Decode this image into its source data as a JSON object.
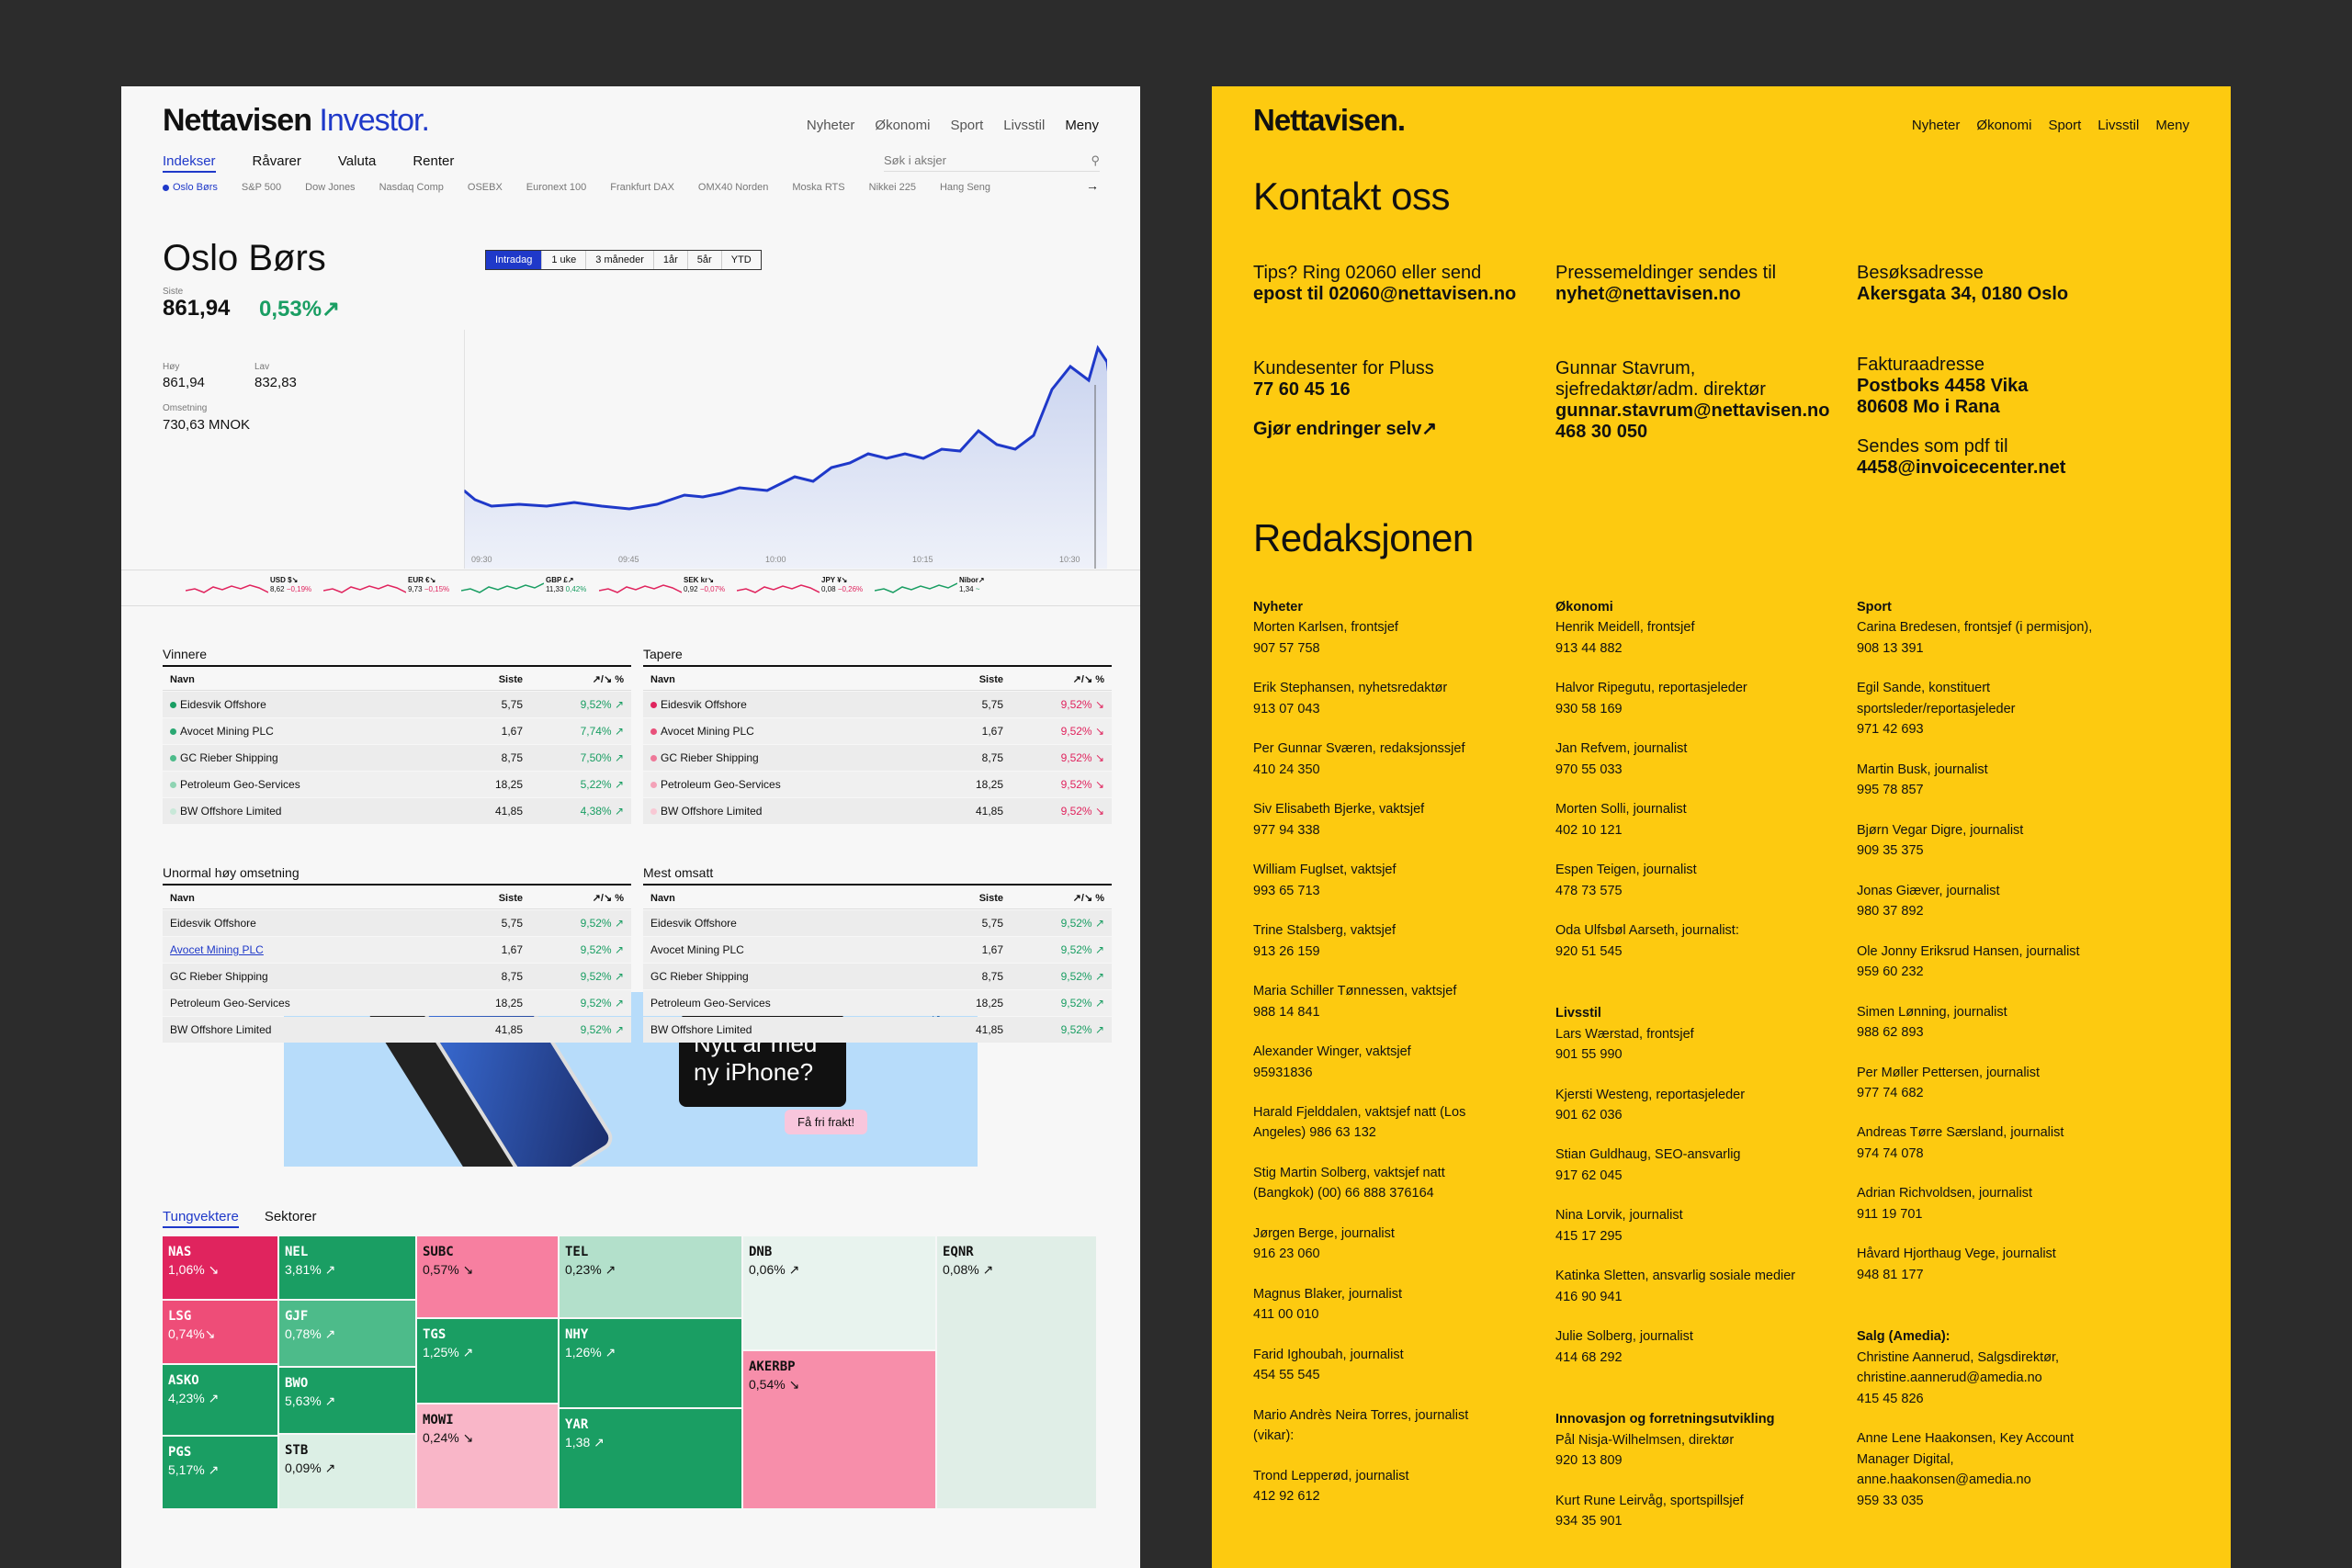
{
  "left": {
    "logo_main": "Nettavisen",
    "logo_sub": "Investor.",
    "nav": [
      "Nyheter",
      "Økonomi",
      "Sport",
      "Livsstil",
      "Meny"
    ],
    "tabs": [
      "Indekser",
      "Råvarer",
      "Valuta",
      "Renter"
    ],
    "search_placeholder": "Søk i aksjer",
    "indices": [
      "Oslo Børs",
      "S&P 500",
      "Dow Jones",
      "Nasdaq Comp",
      "OSEBX",
      "Euronext 100",
      "Frankfurt DAX",
      "OMX40 Norden",
      "Moska RTS",
      "Nikkei 225",
      "Hang Seng"
    ],
    "title": "Oslo Børs",
    "last_label": "Siste",
    "last_value": "861,94",
    "change": "0,53%↗",
    "high_label": "Høy",
    "high_value": "861,94",
    "low_label": "Lav",
    "low_value": "832,83",
    "turnover_label": "Omsetning",
    "turnover_value": "730,63 MNOK",
    "ranges": [
      "Intradag",
      "1 uke",
      "3 måneder",
      "1år",
      "5år",
      "YTD"
    ],
    "chart_times": [
      "09:30",
      "09:45",
      "10:00",
      "10:15",
      "10:30"
    ],
    "tickers": [
      {
        "name": "USD $↘",
        "value": "8,62",
        "chg": "−0,19%",
        "dir": "dn"
      },
      {
        "name": "EUR €↘",
        "value": "9,73",
        "chg": "−0,15%",
        "dir": "dn"
      },
      {
        "name": "GBP £↗",
        "value": "11,33",
        "chg": "0,42%",
        "dir": "up"
      },
      {
        "name": "SEK kr↘",
        "value": "0,92",
        "chg": "−0,07%",
        "dir": "dn"
      },
      {
        "name": "JPY ¥↘",
        "value": "0,08",
        "chg": "−0,26%",
        "dir": "dn"
      },
      {
        "name": "Nibor↗",
        "value": "1,34",
        "chg": "~",
        "dir": "up"
      }
    ],
    "tables": [
      {
        "caption": "Vinnere",
        "head": [
          "Navn",
          "Siste",
          "↗/↘ %"
        ],
        "dots": true,
        "rows": [
          [
            "Eidesvik Offshore",
            "5,75",
            "9,52% ↗",
            "up",
            "#1a9e63"
          ],
          [
            "Avocet Mining PLC",
            "1,67",
            "7,74% ↗",
            "up",
            "#2aa873"
          ],
          [
            "GC Rieber Shipping",
            "8,75",
            "7,50% ↗",
            "up",
            "#4dbb8a"
          ],
          [
            "Petroleum Geo-Services",
            "18,25",
            "5,22% ↗",
            "up",
            "#8fd4b3"
          ],
          [
            "BW Offshore Limited",
            "41,85",
            "4,38% ↗",
            "up",
            "#c8e8d8"
          ]
        ]
      },
      {
        "caption": "Tapere",
        "head": [
          "Navn",
          "Siste",
          "↗/↘ %"
        ],
        "dots": true,
        "rows": [
          [
            "Eidesvik Offshore",
            "5,75",
            "9,52% ↘",
            "dn",
            "#e0245e"
          ],
          [
            "Avocet Mining PLC",
            "1,67",
            "9,52% ↘",
            "dn",
            "#e8507a"
          ],
          [
            "GC Rieber Shipping",
            "8,75",
            "9,52% ↘",
            "dn",
            "#ee7898"
          ],
          [
            "Petroleum Geo-Services",
            "18,25",
            "9,52% ↘",
            "dn",
            "#f4a2b8"
          ],
          [
            "BW Offshore Limited",
            "41,85",
            "9,52% ↘",
            "dn",
            "#f8c8d4"
          ]
        ]
      },
      {
        "caption": "Unormal høy omsetning",
        "head": [
          "Navn",
          "Siste",
          "↗/↘ %"
        ],
        "dots": false,
        "rows": [
          [
            "Eidesvik Offshore",
            "5,75",
            "9,52% ↗",
            "up",
            ""
          ],
          [
            "Avocet Mining PLC",
            "1,67",
            "9,52% ↗",
            "up",
            ""
          ],
          [
            "GC Rieber Shipping",
            "8,75",
            "9,52% ↗",
            "up",
            ""
          ],
          [
            "Petroleum Geo-Services",
            "18,25",
            "9,52% ↗",
            "up",
            ""
          ],
          [
            "BW Offshore Limited",
            "41,85",
            "9,52% ↗",
            "up",
            ""
          ]
        ]
      },
      {
        "caption": "Mest omsatt",
        "head": [
          "Navn",
          "Siste",
          "↗/↘ %"
        ],
        "dots": false,
        "rows": [
          [
            "Eidesvik Offshore",
            "5,75",
            "9,52% ↗",
            "up",
            ""
          ],
          [
            "Avocet Mining PLC",
            "1,67",
            "9,52% ↗",
            "up",
            ""
          ],
          [
            "GC Rieber Shipping",
            "8,75",
            "9,52% ↗",
            "up",
            ""
          ],
          [
            "Petroleum Geo-Services",
            "18,25",
            "9,52% ↗",
            "up",
            ""
          ],
          [
            "BW Offshore Limited",
            "41,85",
            "9,52% ↗",
            "up",
            ""
          ]
        ]
      }
    ],
    "ad_text1": "Nytt år med",
    "ad_text2": "ny iPhone?",
    "ad_cta": "Få fri frakt!",
    "heat_tabs": [
      "Tungvektere",
      "Sektorer"
    ],
    "tiles": [
      {
        "name": "NAS",
        "val": "1,06% ↘"
      },
      {
        "name": "NEL",
        "val": "3,81% ↗"
      },
      {
        "name": "SUBC",
        "val": "0,57% ↘"
      },
      {
        "name": "TEL",
        "val": "0,23% ↗"
      },
      {
        "name": "DNB",
        "val": "0,06% ↗"
      },
      {
        "name": "EQNR",
        "val": "0,08% ↗"
      },
      {
        "name": "LSG",
        "val": "0,74%↘"
      },
      {
        "name": "GJF",
        "val": "0,78% ↗"
      },
      {
        "name": "TGS",
        "val": "1,25% ↗"
      },
      {
        "name": "NHY",
        "val": "1,26% ↗"
      },
      {
        "name": "AKERBP",
        "val": "0,54% ↘"
      },
      {
        "name": "ASKO",
        "val": "4,23% ↗"
      },
      {
        "name": "BWO",
        "val": "5,63% ↗"
      },
      {
        "name": "MOWI",
        "val": "0,24% ↘"
      },
      {
        "name": "YAR",
        "val": "1,38 ↗"
      },
      {
        "name": "PGS",
        "val": "5,17% ↗"
      },
      {
        "name": "STB",
        "val": "0,09% ↗"
      }
    ]
  },
  "right": {
    "logo": "Nettavisen.",
    "nav": [
      "Nyheter",
      "Økonomi",
      "Sport",
      "Livsstil",
      "Meny"
    ],
    "title": "Kontakt oss",
    "contacts": [
      {
        "l1": "Tips? Ring 02060 eller send",
        "l2": "epost til 02060@nettavisen.no",
        "l3": ""
      },
      {
        "l1": "Pressemeldinger sendes til",
        "l2": "nyhet@nettavisen.no",
        "l3": ""
      },
      {
        "l1": "Besøksadresse",
        "l2": "Akersgata 34, 0180 Oslo",
        "l3": ""
      },
      {
        "l1": "Kundesenter for Pluss",
        "l2": "77 60 45 16",
        "l3": "Gjør endringer selv↗"
      },
      {
        "l1": "Gunnar Stavrum,",
        "l2": "sjefredaktør/adm. direktør",
        "b1": "gunnar.stavrum@nettavisen.no",
        "b2": "468 30 050"
      },
      {
        "l1": "Fakturaadresse",
        "b1": "Postboks 4458 Vika",
        "b2": "80608 Mo i Rana",
        "l3": "Sendes som pdf til",
        "b3": "4458@invoicecenter.net"
      }
    ],
    "staff_title": "Redaksjonen",
    "col1": {
      "sec": "Nyheter",
      "items": [
        [
          "Morten Karlsen, frontsjef",
          "907 57 758"
        ],
        [
          "Erik Stephansen, nyhetsredaktør",
          "913 07 043"
        ],
        [
          "Per Gunnar Sværen, redaksjonssjef",
          "410 24 350"
        ],
        [
          "Siv Elisabeth Bjerke, vaktsjef",
          "977 94 338"
        ],
        [
          "William Fuglset, vaktsjef",
          "993 65 713"
        ],
        [
          "Trine Stalsberg, vaktsjef",
          "913 26 159"
        ],
        [
          "Maria Schiller Tønnessen, vaktsjef",
          "988 14 841"
        ],
        [
          "Alexander Winger, vaktsjef",
          "95931836"
        ],
        [
          "Harald Fjelddalen, vaktsjef natt (Los",
          "Angeles) 986 63 132"
        ],
        [
          "Stig Martin Solberg, vaktsjef natt",
          "(Bangkok) (00) 66 888 376164"
        ],
        [
          "Jørgen Berge, journalist",
          "916 23 060"
        ],
        [
          "Magnus Blaker, journalist",
          "411 00 010"
        ],
        [
          "Farid Ighoubah, journalist",
          "454 55 545"
        ],
        [
          "Mario Andrès Neira Torres, journalist",
          "(vikar):"
        ],
        [
          "Trond Lepperød, journalist",
          "412 92 612"
        ]
      ]
    },
    "col2": {
      "sec": "Økonomi",
      "items": [
        [
          "Henrik Meidell, frontsjef",
          "913 44 882"
        ],
        [
          "Halvor Ripegutu, reportasjeleder",
          "930 58 169"
        ],
        [
          "Jan Refvem, journalist",
          "970 55 033"
        ],
        [
          "Morten Solli, journalist",
          "402 10 121"
        ],
        [
          "Espen Teigen, journalist",
          "478 73 575"
        ],
        [
          "Oda Ulfsbøl Aarseth, journalist:",
          "920 51 545"
        ]
      ],
      "sec2": "Livsstil",
      "items2": [
        [
          "Lars Wærstad, frontsjef",
          "901 55 990"
        ],
        [
          "Kjersti Westeng, reportasjeleder",
          "901 62 036"
        ],
        [
          "Stian Guldhaug, SEO-ansvarlig",
          "917 62 045"
        ],
        [
          "Nina Lorvik, journalist",
          "415 17 295"
        ],
        [
          "Katinka Sletten, ansvarlig sosiale medier",
          "416 90 941"
        ],
        [
          "Julie Solberg, journalist",
          "414 68 292"
        ]
      ],
      "sec3": "Innovasjon og forretningsutvikling",
      "items3": [
        [
          "Pål Nisja-Wilhelmsen, direktør",
          "920 13 809"
        ],
        [
          "Kurt Rune Leirvåg, sportspillsjef",
          "934 35 901"
        ]
      ]
    },
    "col3": {
      "sec": "Sport",
      "items": [
        [
          "Carina Bredesen, frontsjef (i permisjon),",
          "908 13 391"
        ],
        [
          "Egil Sande, konstituert",
          "sportsleder/reportasjeleder",
          "971 42 693"
        ],
        [
          "Martin Busk, journalist",
          "995 78 857"
        ],
        [
          "Bjørn Vegar Digre, journalist",
          "909 35 375"
        ],
        [
          "Jonas Giæver, journalist",
          "980 37 892"
        ],
        [
          "Ole Jonny Eriksrud Hansen, journalist",
          "959 60 232"
        ],
        [
          "Simen Lønning, journalist",
          "988 62 893"
        ],
        [
          "Per Møller Pettersen, journalist",
          "977 74 682"
        ],
        [
          "Andreas Tørre Særsland, journalist",
          "974 74 078"
        ],
        [
          "Adrian Richvoldsen, journalist",
          "911 19 701"
        ],
        [
          "Håvard Hjorthaug Vege, journalist",
          "948 81 177"
        ]
      ],
      "sec2": "Salg (Amedia):",
      "items2": [
        [
          "Christine Aannerud, Salgsdirektør,",
          "christine.aannerud@amedia.no",
          "415 45 826"
        ],
        [
          "Anne Lene Haakonsen, Key Account",
          "Manager Digital,",
          "anne.haakonsen@amedia.no",
          "959 33 035"
        ]
      ]
    }
  },
  "colors": {
    "accent_blue": "#1f39c9",
    "up_green": "#1a9e63",
    "down_pink": "#e0245e",
    "yellow": "#fdca10"
  }
}
